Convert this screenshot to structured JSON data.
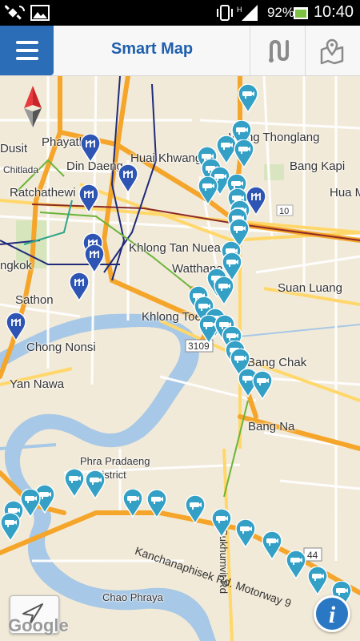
{
  "status_bar": {
    "battery_percent": "92%",
    "time": "10:40"
  },
  "app_bar": {
    "title": "Smart Map"
  },
  "map": {
    "places": [
      {
        "name": "Dusit"
      },
      {
        "name": "Chitlada"
      },
      {
        "name": "Phayathai"
      },
      {
        "name": "Din Daeng"
      },
      {
        "name": "Huai Khwang"
      },
      {
        "name": "Wang Thonglang"
      },
      {
        "name": "Bang Kapi"
      },
      {
        "name": "Ratchathewi"
      },
      {
        "name": "Hua M"
      },
      {
        "name": "ngkok"
      },
      {
        "name": "Khlong Tan Nuea"
      },
      {
        "name": "Watthana"
      },
      {
        "name": "Suan Luang"
      },
      {
        "name": "Sathon"
      },
      {
        "name": "Khlong Toei"
      },
      {
        "name": "Chong Nonsi"
      },
      {
        "name": "Bang Chak"
      },
      {
        "name": "Yan Nawa"
      },
      {
        "name": "Bang Na"
      },
      {
        "name": "Phra Pradaeng"
      },
      {
        "name": "District"
      },
      {
        "name": "Chao Phraya"
      }
    ],
    "roads": [
      {
        "name": "Kanchanaphisek Rd. Motorway 9"
      },
      {
        "name": "Sukhumvit Rd"
      }
    ],
    "route_shields": [
      "10",
      "3109",
      "44"
    ],
    "attribution": "Google"
  },
  "colors": {
    "brand_blue": "#2b6db7",
    "title_blue": "#1f5fae",
    "camera_marker": "#34a0c6",
    "thai_marker": "#2e55b3",
    "expressway": "#f4a52a",
    "water": "#a7c8e6",
    "land": "#f2ead8"
  }
}
